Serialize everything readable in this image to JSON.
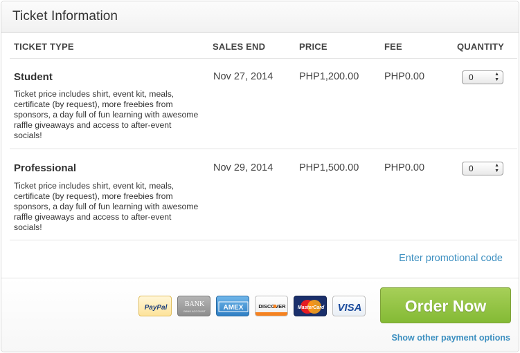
{
  "panel": {
    "title": "Ticket Information"
  },
  "columns": {
    "ticket_type": "TICKET TYPE",
    "sales_end": "SALES END",
    "price": "PRICE",
    "fee": "FEE",
    "quantity": "QUANTITY"
  },
  "tickets": [
    {
      "name": "Student",
      "description": "Ticket price includes shirt, event kit, meals, certificate (by request), more freebies from sponsors, a day full of fun learning with awesome raffle giveaways and access to after-event socials!",
      "sales_end": "Nov 27, 2014",
      "price": "PHP1,200.00",
      "fee": "PHP0.00",
      "quantity": "0"
    },
    {
      "name": "Professional",
      "description": "Ticket price includes shirt, event kit, meals, certificate (by request), more freebies from sponsors, a day full of fun learning with awesome raffle giveaways and access to after-event socials!",
      "sales_end": "Nov 29, 2014",
      "price": "PHP1,500.00",
      "fee": "PHP0.00",
      "quantity": "0"
    }
  ],
  "promo_link": "Enter promotional code",
  "payment_methods": [
    {
      "icon": "paypal-icon",
      "label": "PayPal"
    },
    {
      "icon": "bank-icon",
      "label": "BANK",
      "sublabel": "BANK ACCOUNT"
    },
    {
      "icon": "amex-icon",
      "label": "AMEX"
    },
    {
      "icon": "discover-icon",
      "label": "DISCOVER"
    },
    {
      "icon": "mastercard-icon",
      "label": "MasterCard"
    },
    {
      "icon": "visa-icon",
      "label": "VISA"
    }
  ],
  "order_button": "Order Now",
  "other_payment_link": "Show other payment options",
  "colors": {
    "accent_link": "#3c8fc0",
    "order_button_green": "#8fc142"
  }
}
